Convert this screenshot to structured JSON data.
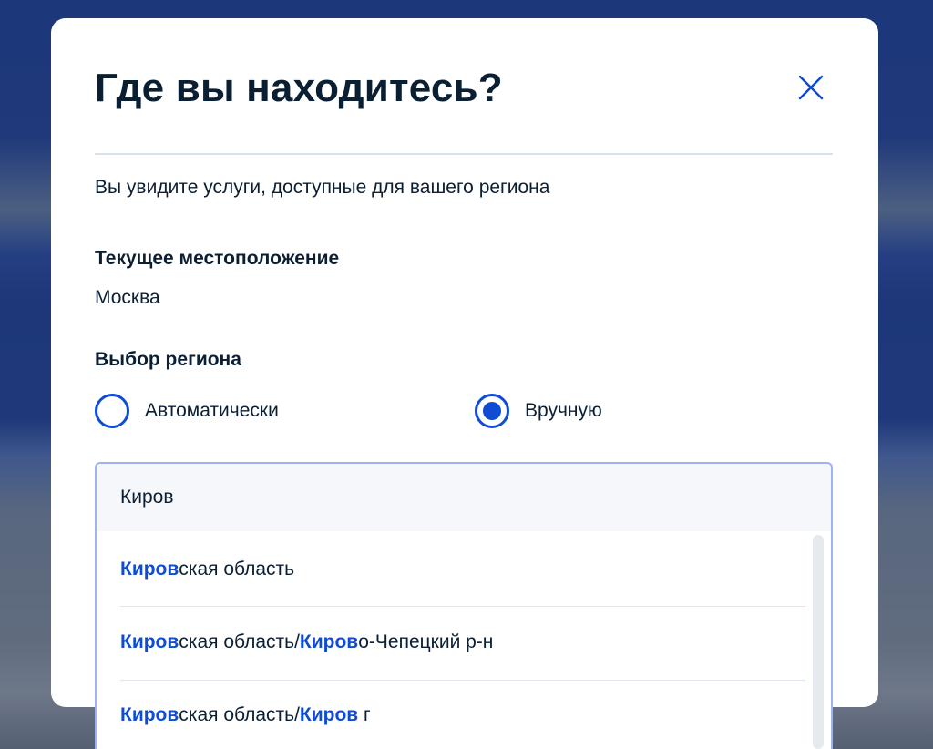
{
  "modal": {
    "title": "Где вы находитесь?",
    "subtitle": "Вы увидите услуги, доступные для вашего региона",
    "current_location_label": "Текущее местоположение",
    "current_location_value": "Москва",
    "region_choice_label": "Выбор региона",
    "close_icon": "close-icon"
  },
  "radio": {
    "auto_label": "Автоматически",
    "manual_label": "Вручную",
    "selected": "manual"
  },
  "search": {
    "value": "Киров"
  },
  "suggestions": [
    {
      "parts": [
        "Киров",
        "ская область"
      ]
    },
    {
      "parts": [
        "Киров",
        "ская область/",
        "Киров",
        "о-Чепецкий р-н"
      ]
    },
    {
      "parts": [
        "Киров",
        "ская область/",
        "Киров",
        " г"
      ]
    }
  ],
  "colors": {
    "accent": "#0d4cd3",
    "text": "#0b1f33",
    "input_border": "#9db4ee"
  }
}
